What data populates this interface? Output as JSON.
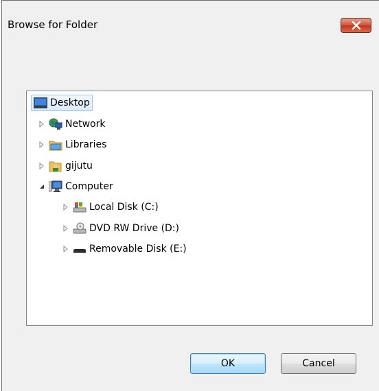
{
  "window": {
    "title": "Browse for Folder"
  },
  "tree": {
    "items": [
      {
        "label": "Desktop",
        "icon": "desktop-icon",
        "selected": true
      },
      {
        "label": "Network",
        "icon": "network-icon"
      },
      {
        "label": "Libraries",
        "icon": "libraries-icon"
      },
      {
        "label": "gijutu",
        "icon": "user-folder-icon"
      },
      {
        "label": "Computer",
        "icon": "computer-icon",
        "expanded": true
      },
      {
        "label": "Local Disk (C:)",
        "icon": "local-disk-icon"
      },
      {
        "label": "DVD RW Drive (D:)",
        "icon": "dvd-drive-icon"
      },
      {
        "label": "Removable Disk (E:)",
        "icon": "removable-disk-icon"
      }
    ]
  },
  "buttons": {
    "ok_label": "OK",
    "cancel_label": "Cancel"
  },
  "colors": {
    "close_button": "#c3351c",
    "selection": "#dcebfc",
    "selection_border": "#99c7f3"
  }
}
